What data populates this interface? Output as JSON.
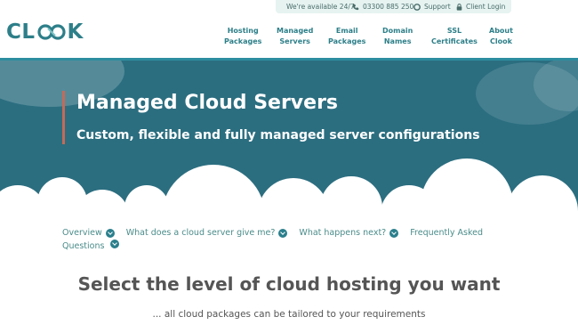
{
  "topbar": {
    "available": "We're available 24/7",
    "phone": "03300 885 250",
    "support": "Support",
    "login": "Client Login"
  },
  "logo": {
    "text_left": "CL",
    "text_right": "K"
  },
  "nav": [
    {
      "line1": "Hosting",
      "line2": "Packages"
    },
    {
      "line1": "Managed",
      "line2": "Servers"
    },
    {
      "line1": "Email",
      "line2": "Packages"
    },
    {
      "line1": "Domain",
      "line2": "Names"
    },
    {
      "line1": "SSL",
      "line2": "Certificates"
    },
    {
      "line1": "About",
      "line2": "Clook"
    }
  ],
  "hero": {
    "title": "Managed Cloud Servers",
    "subtitle": "Custom, flexible and fully managed server configurations"
  },
  "anchors": [
    "Overview",
    "What does a cloud server give me?",
    "What happens next?",
    "Frequently Asked Questions"
  ],
  "section": {
    "title": "Select the level of cloud hosting you want",
    "subtitle": "... all cloud packages can be tailored to your requirements"
  },
  "colors": {
    "brand": "#2d7f89",
    "hero_bg": "#2b6e80",
    "accent": "#c56a57"
  }
}
